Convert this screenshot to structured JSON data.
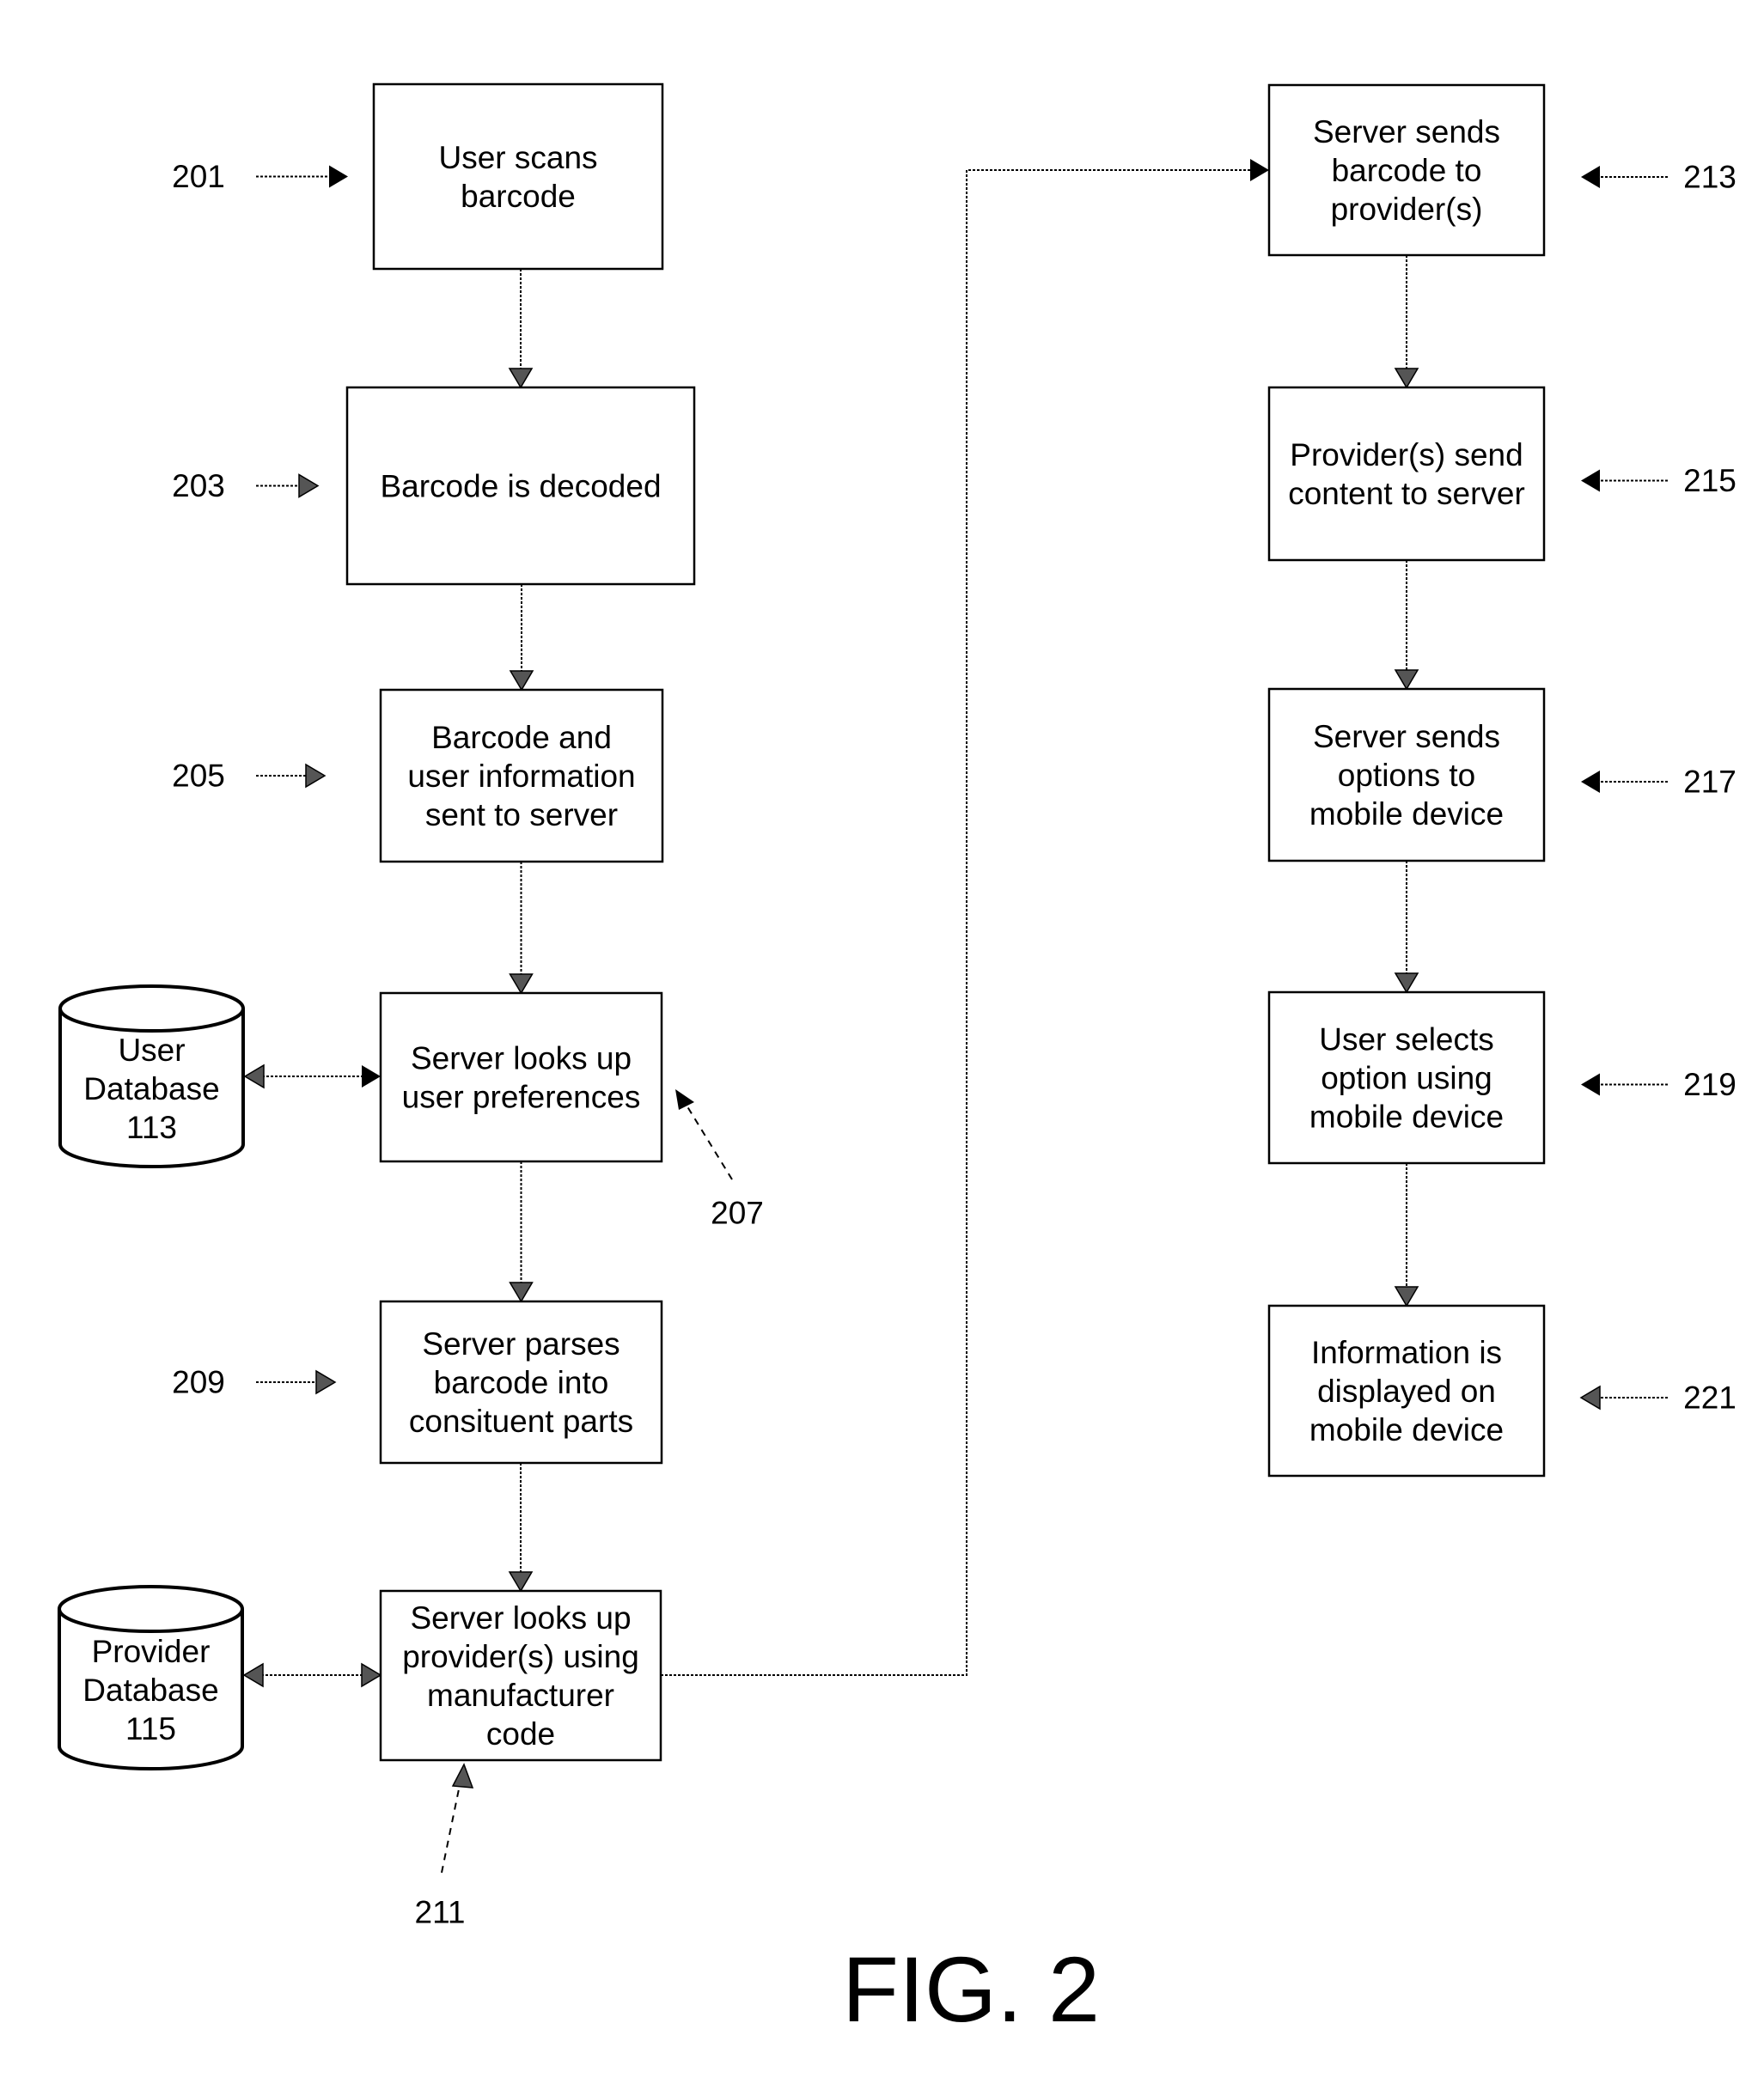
{
  "figure": {
    "title": "FIG. 2"
  },
  "steps": [
    {
      "id": "201",
      "ref": "201",
      "lines": [
        "User scans",
        "barcode"
      ]
    },
    {
      "id": "203",
      "ref": "203",
      "lines": [
        "Barcode is decoded"
      ]
    },
    {
      "id": "205",
      "ref": "205",
      "lines": [
        "Barcode and",
        "user information",
        "sent to server"
      ]
    },
    {
      "id": "207",
      "ref": "207",
      "lines": [
        "Server looks up",
        "user preferences"
      ]
    },
    {
      "id": "209",
      "ref": "209",
      "lines": [
        "Server parses",
        "barcode into",
        "consituent parts"
      ]
    },
    {
      "id": "211",
      "ref": "211",
      "lines": [
        "Server looks up",
        "provider(s) using",
        "manufacturer",
        "code"
      ]
    },
    {
      "id": "213",
      "ref": "213",
      "lines": [
        "Server sends",
        "barcode to",
        "provider(s)"
      ]
    },
    {
      "id": "215",
      "ref": "215",
      "lines": [
        "Provider(s) send",
        "content to server"
      ]
    },
    {
      "id": "217",
      "ref": "217",
      "lines": [
        "Server sends",
        "options to",
        "mobile device"
      ]
    },
    {
      "id": "219",
      "ref": "219",
      "lines": [
        "User selects",
        "option using",
        "mobile device"
      ]
    },
    {
      "id": "221",
      "ref": "221",
      "lines": [
        "Information is",
        "displayed on",
        "mobile device"
      ]
    }
  ],
  "databases": [
    {
      "id": "113",
      "lines": [
        "User",
        "Database",
        "113"
      ],
      "linked_step": "207"
    },
    {
      "id": "115",
      "lines": [
        "Provider",
        "Database",
        "115"
      ],
      "linked_step": "211"
    }
  ],
  "flow": [
    [
      "201",
      "203"
    ],
    [
      "203",
      "205"
    ],
    [
      "205",
      "207"
    ],
    [
      "207",
      "209"
    ],
    [
      "209",
      "211"
    ],
    [
      "211",
      "213"
    ],
    [
      "213",
      "215"
    ],
    [
      "215",
      "217"
    ],
    [
      "217",
      "219"
    ],
    [
      "219",
      "221"
    ]
  ]
}
